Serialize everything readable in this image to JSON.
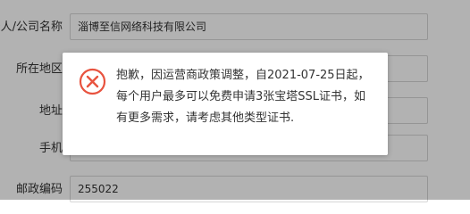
{
  "form": {
    "fields": [
      {
        "label": "个人/公司名称",
        "value": "淄博至信网络科技有限公司"
      },
      {
        "label": "所在地区",
        "value": ""
      },
      {
        "label": "地址",
        "value": ""
      },
      {
        "label": "手机",
        "value": ""
      },
      {
        "label": "邮政编码",
        "value": "255022"
      }
    ]
  },
  "dialog": {
    "icon": "error-circle-x-icon",
    "icon_color": "#e8533f",
    "message": "抱歉，因运营商政策调整，自2021-07-25日起，每个用户最多可以免费申请3张宝塔SSL证书，如有更多需求，请考虑其他类型证书."
  }
}
